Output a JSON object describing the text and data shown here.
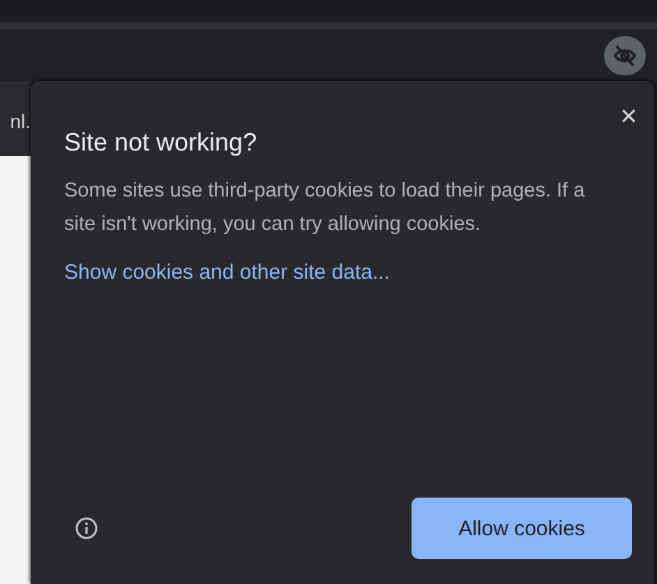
{
  "page": {
    "cut_text": "nl."
  },
  "popup": {
    "title": "Site not working?",
    "body": "Some sites use third-party cookies to load their pages. If a site isn't working, you can try allowing cookies.",
    "link": "Show cookies and other site data...",
    "close": "✕",
    "button": "Allow cookies"
  }
}
